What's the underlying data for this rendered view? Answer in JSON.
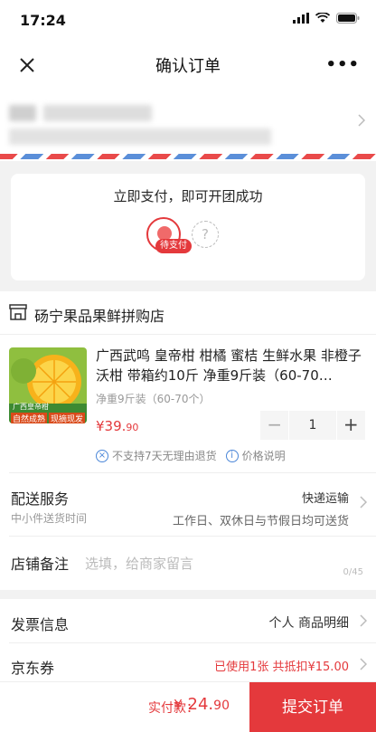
{
  "status_bar": {
    "time": "17:24"
  },
  "nav": {
    "title": "确认订单"
  },
  "group": {
    "message": "立即支付，即可开团成功",
    "badge": "待支付",
    "empty_slot": "?"
  },
  "shop": {
    "name": "砀宁果品果鲜拼购店"
  },
  "product": {
    "title": "广西武鸣 皇帝柑 柑橘 蜜桔 生鲜水果 非橙子沃柑 带箱约10斤 净重9斤装（60-70…",
    "sku": "净重9斤装（60-70个）",
    "price_main": "¥39.",
    "price_decimal": "90",
    "quantity": "1",
    "minus": "−",
    "plus": "+",
    "no_return": "不支持7天无理由退货",
    "price_note": "价格说明",
    "image_label": "广西皇帝柑",
    "image_tags": [
      "自然成熟",
      "现摘现发"
    ]
  },
  "delivery": {
    "label": "配送服务",
    "sub": "中小件送货时间",
    "method": "快递运输",
    "time": "工作日、双休日与节假日均可送货"
  },
  "remark": {
    "label": "店铺备注",
    "placeholder": "选填，给商家留言",
    "count": "0/45"
  },
  "invoice": {
    "label": "发票信息",
    "value": "个人 商品明细"
  },
  "coupon": {
    "label": "京东券",
    "value": "已使用1张 共抵扣¥15.00"
  },
  "footer": {
    "pay_label": "实付款：",
    "pay_currency": "¥",
    "pay_main": "24.",
    "pay_decimal": "90",
    "submit": "提交订单"
  },
  "colors": {
    "accent": "#e4393c",
    "link": "#4a86d8"
  }
}
